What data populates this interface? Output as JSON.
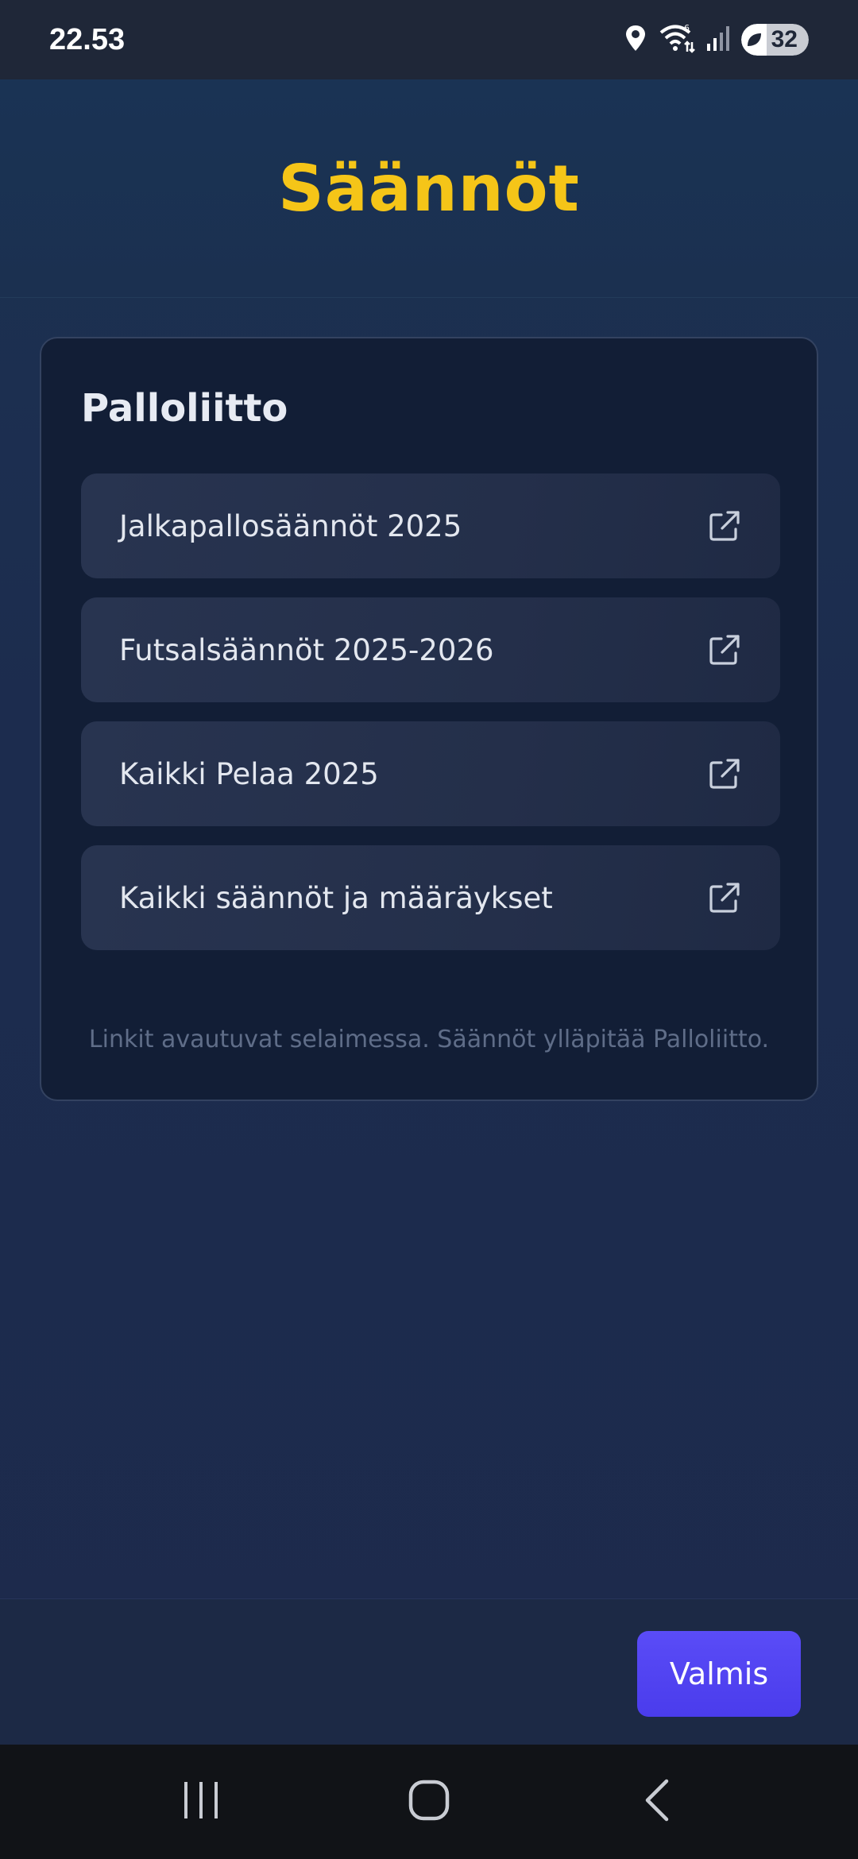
{
  "status_bar": {
    "time": "22.53",
    "battery": "32"
  },
  "header": {
    "title": "Säännöt"
  },
  "card": {
    "title": "Palloliitto",
    "links": [
      {
        "label": "Jalkapallosäännöt 2025",
        "icon": "external-link-icon"
      },
      {
        "label": "Futsalsäännöt 2025-2026",
        "icon": "external-link-icon"
      },
      {
        "label": "Kaikki Pelaa 2025",
        "icon": "external-link-icon"
      },
      {
        "label": "Kaikki säännöt ja määräykset",
        "icon": "external-link-icon"
      }
    ],
    "footnote": "Linkit avautuvat selaimessa. Säännöt ylläpitää Palloliitto."
  },
  "footer": {
    "done_label": "Valmis"
  },
  "colors": {
    "title": "#f5c518",
    "button": "#4f41f0",
    "card_bg": "#121e36"
  }
}
